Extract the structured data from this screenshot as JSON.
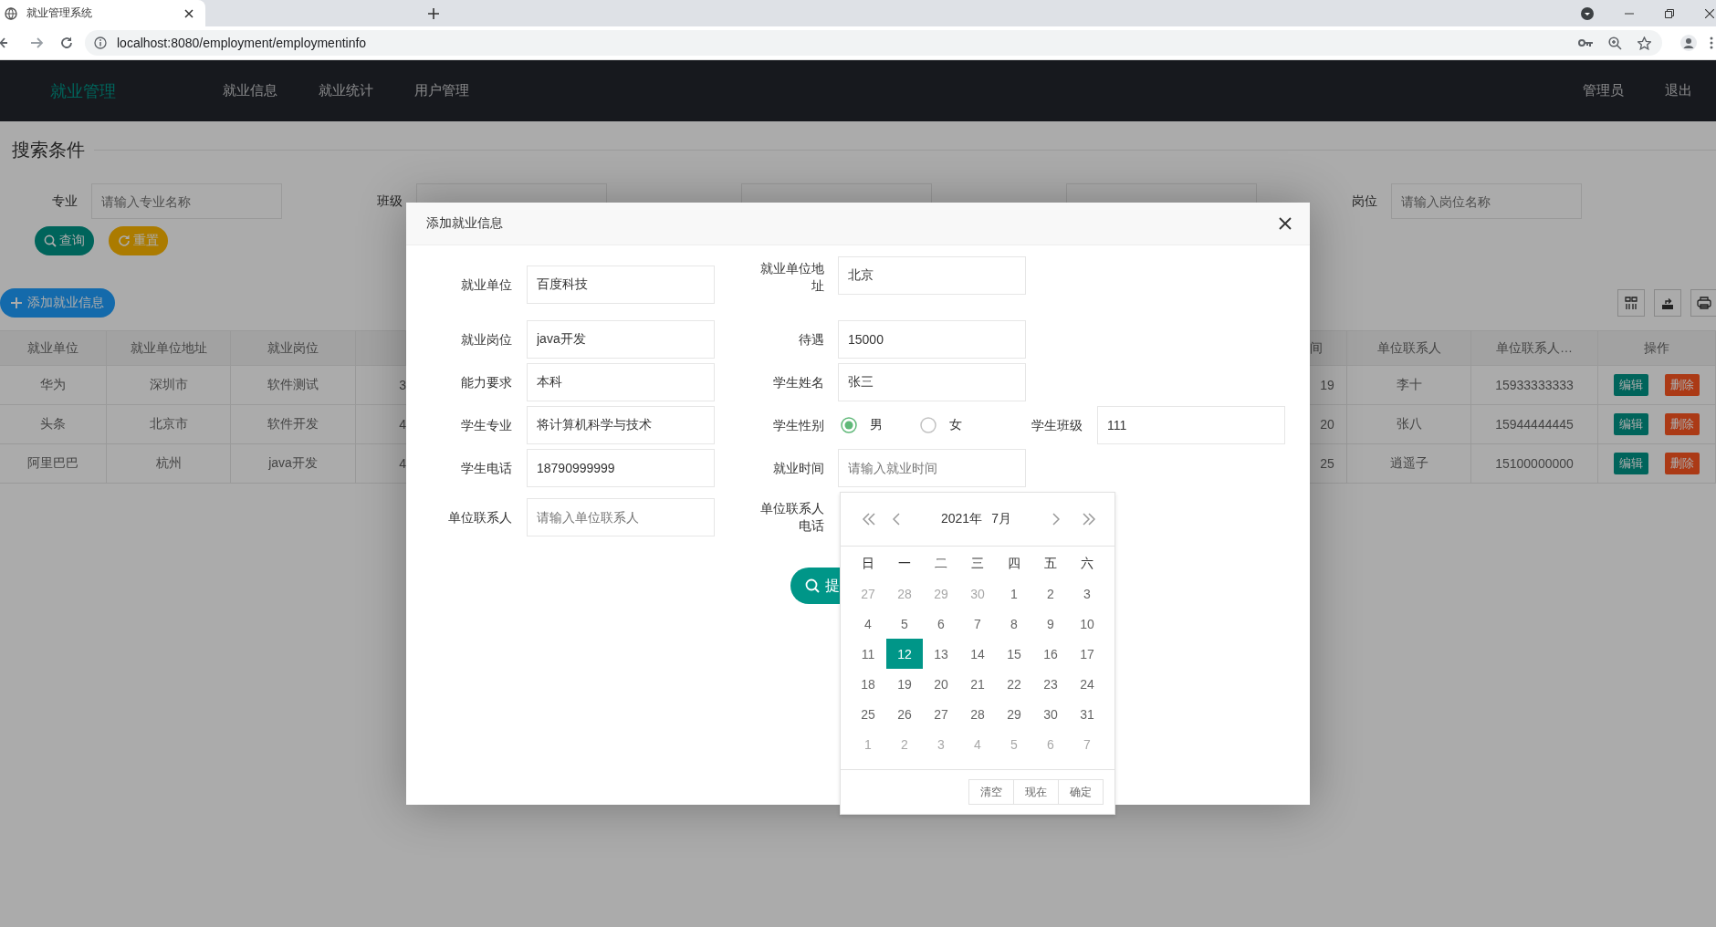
{
  "browser": {
    "tab_title": "就业管理系统",
    "url": "localhost:8080/employment/employmentinfo"
  },
  "nav": {
    "logo": "就业管理",
    "items": [
      {
        "label": "就业信息"
      },
      {
        "label": "就业统计"
      },
      {
        "label": "用户管理"
      }
    ],
    "user": "管理员",
    "logout": "退出"
  },
  "search": {
    "title": "搜索条件",
    "fields": [
      {
        "kind": "input",
        "label": "专业",
        "placeholder": "请输入专业名称"
      },
      {
        "kind": "input",
        "label": "班级"
      },
      {
        "kind": "input"
      },
      {
        "kind": "input"
      },
      {
        "kind": "input",
        "label": "岗位",
        "placeholder": "请输入岗位名称"
      }
    ],
    "buttons": [
      {
        "label": "查询",
        "kind": "search"
      },
      {
        "label": "重置",
        "kind": "reset"
      }
    ]
  },
  "toolbar": {
    "add_button": "添加就业信息"
  },
  "table": {
    "columns": [
      "就业单位",
      "就业单位地址",
      "就业岗位",
      "",
      "间",
      "单位联系人",
      "单位联系人…",
      "操作"
    ],
    "rows": [
      {
        "cells": [
          "华为",
          "深圳市",
          "软件测试",
          "3",
          "19",
          "李十",
          "15933333333"
        ],
        "actions": [
          {
            "label": "编辑",
            "kind": "edit"
          },
          {
            "label": "删除",
            "kind": "delete"
          }
        ]
      },
      {
        "cells": [
          "头条",
          "北京市",
          "软件开发",
          "4",
          "20",
          "张八",
          "15944444445"
        ],
        "actions": [
          {
            "label": "编辑",
            "kind": "edit"
          },
          {
            "label": "删除",
            "kind": "delete"
          }
        ]
      },
      {
        "cells": [
          "阿里巴巴",
          "杭州",
          "java开发",
          "4",
          "25",
          "逍遥子",
          "15100000000"
        ],
        "actions": [
          {
            "label": "编辑",
            "kind": "edit"
          },
          {
            "label": "删除",
            "kind": "delete"
          }
        ]
      }
    ]
  },
  "modal": {
    "title": "添加就业信息",
    "rows": [
      [
        {
          "kind": "text",
          "label": "就业单位",
          "value": "百度科技"
        },
        {
          "kind": "text",
          "label": "就业单位地址",
          "value": "北京"
        }
      ],
      [
        {
          "kind": "text",
          "label": "就业岗位",
          "value": "java开发"
        },
        {
          "kind": "text",
          "label": "待遇",
          "value": "15000"
        }
      ],
      [
        {
          "kind": "text",
          "label": "能力要求",
          "value": "本科"
        },
        {
          "kind": "text",
          "label": "学生姓名",
          "value": "张三"
        }
      ],
      [
        {
          "kind": "text",
          "label": "学生专业",
          "value": "将计算机科学与技术"
        },
        {
          "kind": "radio",
          "label": "学生性别",
          "options": [
            {
              "label": "男",
              "selected": true
            },
            {
              "label": "女",
              "selected": false
            }
          ]
        },
        {
          "kind": "text",
          "label": "学生班级",
          "value": "111"
        }
      ],
      [
        {
          "kind": "text",
          "label": "学生电话",
          "value": "18790999999"
        },
        {
          "kind": "text",
          "label": "就业时间",
          "placeholder": "请输入就业时间"
        }
      ],
      [
        {
          "kind": "text",
          "label": "单位联系人",
          "placeholder": "请输入单位联系人"
        },
        {
          "kind": "covered",
          "label": "单位联系人电话"
        }
      ]
    ],
    "submit": "提"
  },
  "calendar": {
    "year": "2021年",
    "month": "7月",
    "weekdays": [
      "日",
      "一",
      "二",
      "三",
      "四",
      "五",
      "六"
    ],
    "days": [
      {
        "day": "27",
        "outside": true,
        "selected": false
      },
      {
        "day": "28",
        "outside": true,
        "selected": false
      },
      {
        "day": "29",
        "outside": true,
        "selected": false
      },
      {
        "day": "30",
        "outside": true,
        "selected": false
      },
      {
        "day": "1",
        "outside": false,
        "selected": false
      },
      {
        "day": "2",
        "outside": false,
        "selected": false
      },
      {
        "day": "3",
        "outside": false,
        "selected": false
      },
      {
        "day": "4",
        "outside": false,
        "selected": false
      },
      {
        "day": "5",
        "outside": false,
        "selected": false
      },
      {
        "day": "6",
        "outside": false,
        "selected": false
      },
      {
        "day": "7",
        "outside": false,
        "selected": false
      },
      {
        "day": "8",
        "outside": false,
        "selected": false
      },
      {
        "day": "9",
        "outside": false,
        "selected": false
      },
      {
        "day": "10",
        "outside": false,
        "selected": false
      },
      {
        "day": "11",
        "outside": false,
        "selected": false
      },
      {
        "day": "12",
        "outside": false,
        "selected": true
      },
      {
        "day": "13",
        "outside": false,
        "selected": false
      },
      {
        "day": "14",
        "outside": false,
        "selected": false
      },
      {
        "day": "15",
        "outside": false,
        "selected": false
      },
      {
        "day": "16",
        "outside": false,
        "selected": false
      },
      {
        "day": "17",
        "outside": false,
        "selected": false
      },
      {
        "day": "18",
        "outside": false,
        "selected": false
      },
      {
        "day": "19",
        "outside": false,
        "selected": false
      },
      {
        "day": "20",
        "outside": false,
        "selected": false
      },
      {
        "day": "21",
        "outside": false,
        "selected": false
      },
      {
        "day": "22",
        "outside": false,
        "selected": false
      },
      {
        "day": "23",
        "outside": false,
        "selected": false
      },
      {
        "day": "24",
        "outside": false,
        "selected": false
      },
      {
        "day": "25",
        "outside": false,
        "selected": false
      },
      {
        "day": "26",
        "outside": false,
        "selected": false
      },
      {
        "day": "27",
        "outside": false,
        "selected": false
      },
      {
        "day": "28",
        "outside": false,
        "selected": false
      },
      {
        "day": "29",
        "outside": false,
        "selected": false
      },
      {
        "day": "30",
        "outside": false,
        "selected": false
      },
      {
        "day": "31",
        "outside": false,
        "selected": false
      },
      {
        "day": "1",
        "outside": true,
        "selected": false
      },
      {
        "day": "2",
        "outside": true,
        "selected": false
      },
      {
        "day": "3",
        "outside": true,
        "selected": false
      },
      {
        "day": "4",
        "outside": true,
        "selected": false
      },
      {
        "day": "5",
        "outside": true,
        "selected": false
      },
      {
        "day": "6",
        "outside": true,
        "selected": false
      },
      {
        "day": "7",
        "outside": true,
        "selected": false
      }
    ],
    "buttons": [
      "清空",
      "现在",
      "确定"
    ]
  }
}
